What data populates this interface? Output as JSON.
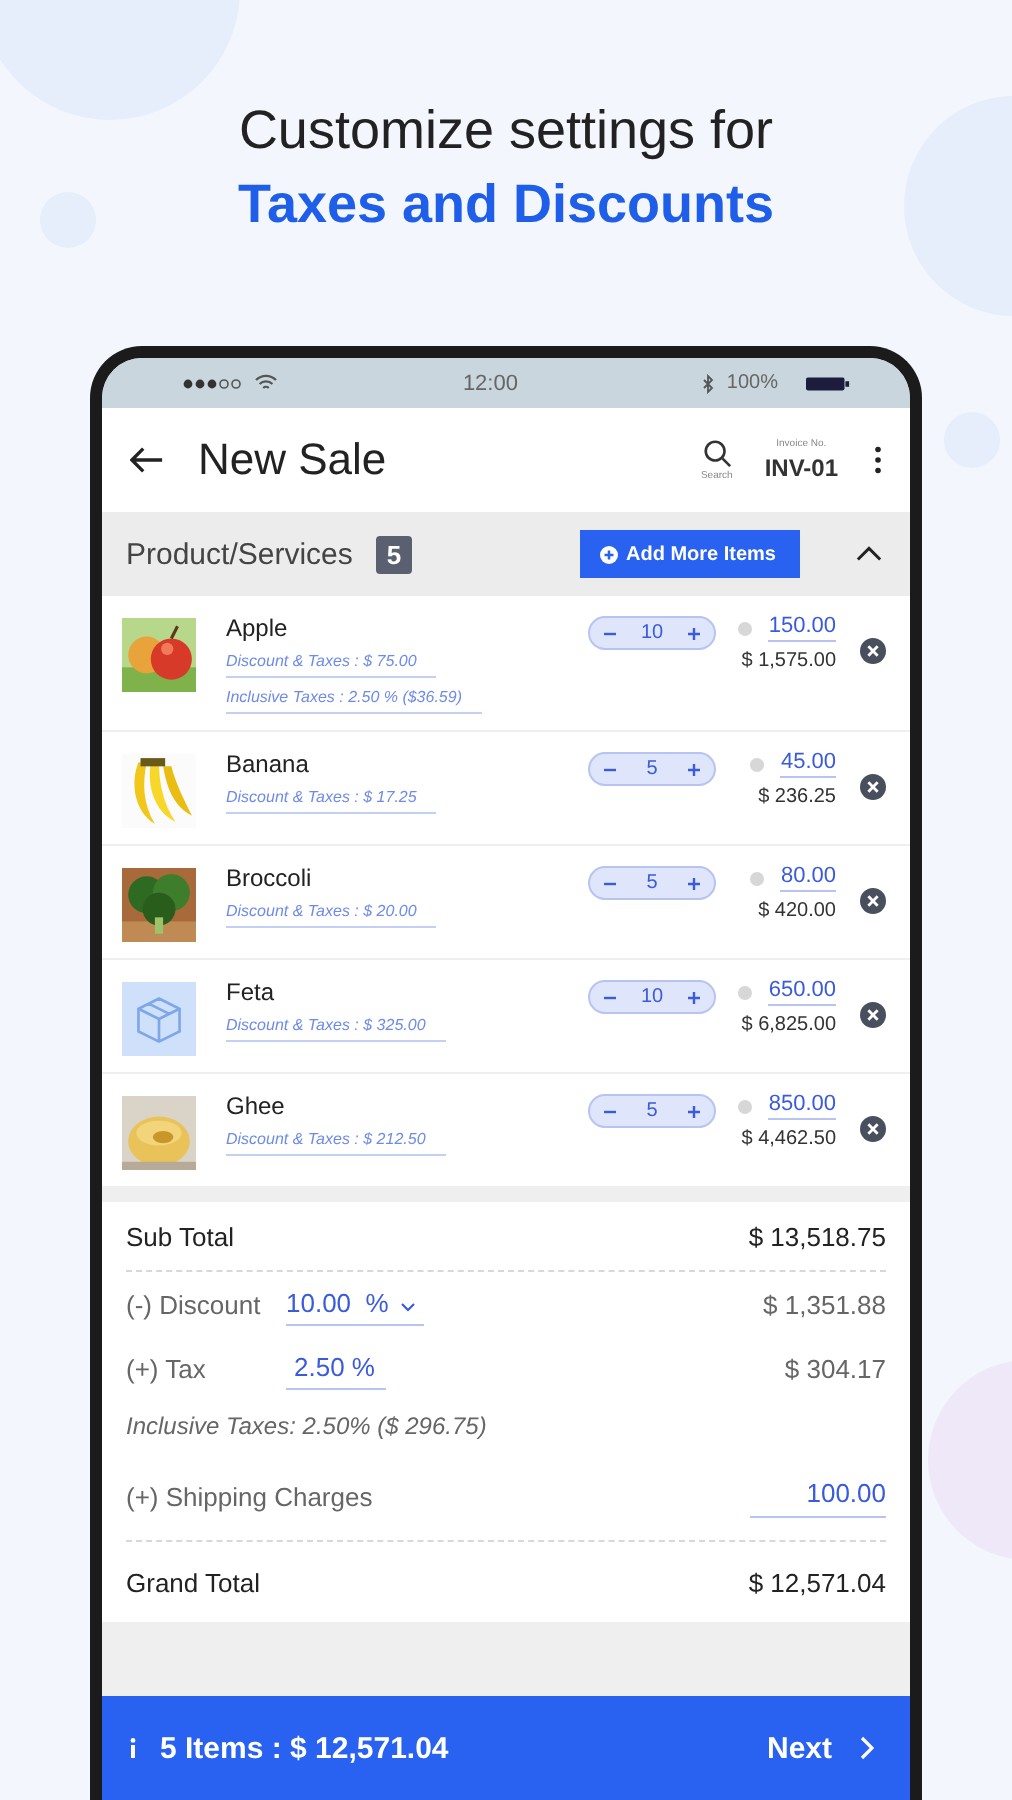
{
  "headline": {
    "line_1": "Customize settings for",
    "line_2": "Taxes and Discounts"
  },
  "status_bar": {
    "time": "12:00",
    "battery": "100%"
  },
  "app_bar": {
    "title": "New Sale",
    "search_label": "Search",
    "invoice_label": "Invoice No.",
    "invoice_number": "INV-01"
  },
  "section": {
    "title": "Product/Services",
    "count": "5",
    "add_button": "Add More Items",
    "expanded": true
  },
  "items": [
    {
      "name": "Apple",
      "details": [
        "Discount & Taxes : $ 75.00",
        "Inclusive Taxes : 2.50 % ($36.59)"
      ],
      "quantity": "10",
      "price": "150.00",
      "total": "$ 1,575.00"
    },
    {
      "name": "Banana",
      "details": [
        "Discount & Taxes : $ 17.25"
      ],
      "quantity": "5",
      "price": "45.00",
      "total": "$ 236.25"
    },
    {
      "name": "Broccoli",
      "details": [
        "Discount & Taxes : $ 20.00"
      ],
      "quantity": "5",
      "price": "80.00",
      "total": "$ 420.00"
    },
    {
      "name": "Feta",
      "kind": "placeholder",
      "details": [
        "Discount & Taxes : $ 325.00"
      ],
      "quantity": "10",
      "price": "650.00",
      "total": "$ 6,825.00"
    },
    {
      "name": "Ghee",
      "details": [
        "Discount & Taxes : $ 212.50"
      ],
      "quantity": "5",
      "price": "850.00",
      "total": "$ 4,462.50"
    }
  ],
  "summary": {
    "subtotal": {
      "label": "Sub Total",
      "value": "$ 13,518.75"
    },
    "discount": {
      "label": "(-) Discount",
      "rate": "10.00  %",
      "value": "$ 1,351.88"
    },
    "tax": {
      "label": "(+) Tax",
      "rate": "2.50 %",
      "value": "$ 304.17"
    },
    "inclusive_note": "Inclusive Taxes: 2.50% ($ 296.75)",
    "shipping": {
      "label": "(+) Shipping Charges",
      "value": "100.00"
    },
    "grand_total": {
      "label": "Grand  Total",
      "value": "$ 12,571.04"
    }
  },
  "footer": {
    "summary": "5 Items : $ 12,571.04",
    "next": "Next"
  }
}
